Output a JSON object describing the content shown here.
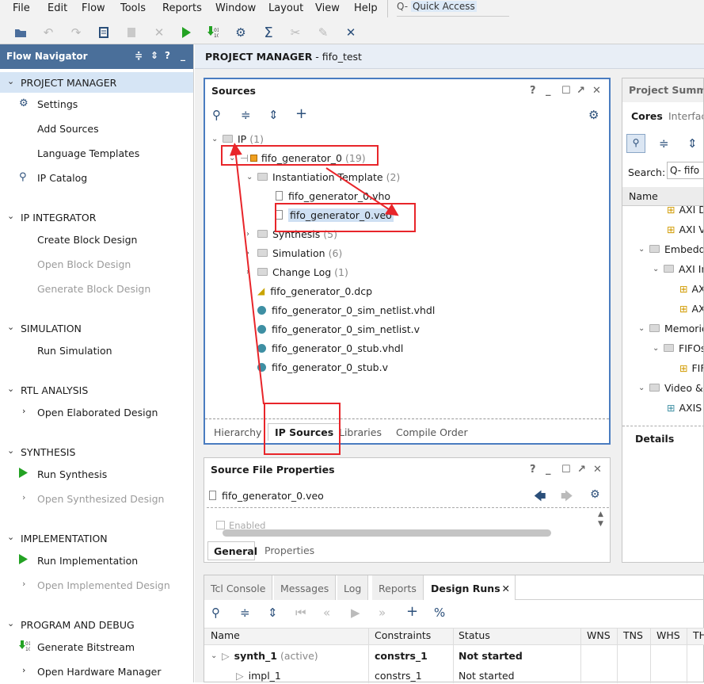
{
  "menu": [
    "File",
    "Edit",
    "Flow",
    "Tools",
    "Reports",
    "Window",
    "Layout",
    "View",
    "Help"
  ],
  "quick_access": {
    "prefix": "Q-",
    "label": "Quick Access"
  },
  "flow_navigator": {
    "title": "Flow Navigator",
    "sections": [
      {
        "label": "PROJECT MANAGER",
        "items": [
          {
            "label": "Settings",
            "icon": "gear-icon",
            "enabled": true
          },
          {
            "label": "Add Sources",
            "enabled": true
          },
          {
            "label": "Language Templates",
            "enabled": true
          },
          {
            "label": "IP Catalog",
            "icon": "ip-catalog-icon",
            "enabled": true
          }
        ]
      },
      {
        "label": "IP INTEGRATOR",
        "items": [
          {
            "label": "Create Block Design",
            "enabled": true
          },
          {
            "label": "Open Block Design",
            "enabled": false
          },
          {
            "label": "Generate Block Design",
            "enabled": false
          }
        ]
      },
      {
        "label": "SIMULATION",
        "items": [
          {
            "label": "Run Simulation",
            "enabled": true
          }
        ]
      },
      {
        "label": "RTL ANALYSIS",
        "items": [
          {
            "label": "Open Elaborated Design",
            "enabled": true
          }
        ]
      },
      {
        "label": "SYNTHESIS",
        "items": [
          {
            "label": "Run Synthesis",
            "icon": "play-icon",
            "enabled": true
          },
          {
            "label": "Open Synthesized Design",
            "enabled": false
          }
        ]
      },
      {
        "label": "IMPLEMENTATION",
        "items": [
          {
            "label": "Run Implementation",
            "icon": "play-icon",
            "enabled": true
          },
          {
            "label": "Open Implemented Design",
            "enabled": false
          }
        ]
      },
      {
        "label": "PROGRAM AND DEBUG",
        "items": [
          {
            "label": "Generate Bitstream",
            "icon": "bitstream-icon",
            "enabled": true
          },
          {
            "label": "Open Hardware Manager",
            "enabled": true
          }
        ]
      }
    ]
  },
  "project_bar": {
    "prefix": "PROJECT MANAGER",
    "suffix": " - fifo_test"
  },
  "sources": {
    "title": "Sources",
    "tree": [
      {
        "label": "IP",
        "count": "(1)"
      },
      {
        "label": "fifo_generator_0",
        "count": "(19)"
      },
      {
        "label": "Instantiation Template",
        "count": "(2)"
      },
      {
        "label": "fifo_generator_0.vho"
      },
      {
        "label": "fifo_generator_0.veo"
      },
      {
        "label": "Synthesis",
        "count": "(5)"
      },
      {
        "label": "Simulation",
        "count": "(6)"
      },
      {
        "label": "Change Log",
        "count": "(1)"
      },
      {
        "label": "fifo_generator_0.dcp"
      },
      {
        "label": "fifo_generator_0_sim_netlist.vhdl"
      },
      {
        "label": "fifo_generator_0_sim_netlist.v"
      },
      {
        "label": "fifo_generator_0_stub.vhdl"
      },
      {
        "label": "fifo_generator_0_stub.v"
      }
    ],
    "tabs": [
      "Hierarchy",
      "IP Sources",
      "Libraries",
      "Compile Order"
    ]
  },
  "source_file_properties": {
    "title": "Source File Properties",
    "file": "fifo_generator_0.veo",
    "enabled_label": "Enabled",
    "tabs": [
      "General",
      "Properties"
    ]
  },
  "project_summary": {
    "title": "Project Summary",
    "tabs": [
      "Cores",
      "Interfac"
    ],
    "search_label": "Search:",
    "search_value": "Q- fifo",
    "col": "Name",
    "rows": [
      "AXI D",
      "AXI Vi",
      "Embedd",
      "AXI In",
      "AX",
      "AX",
      "Memorie",
      "FIFOs",
      "FIF",
      "Video &",
      "AXIS"
    ],
    "details": "Details"
  },
  "console": {
    "tabs": [
      "Tcl Console",
      "Messages",
      "Log",
      "Reports",
      "Design Runs"
    ],
    "columns": [
      "Name",
      "Constraints",
      "Status",
      "WNS",
      "TNS",
      "WHS",
      "TH"
    ],
    "rows": [
      {
        "name": "synth_1",
        "tag": "(active)",
        "constraints": "constrs_1",
        "status": "Not started"
      },
      {
        "name": "impl_1",
        "constraints": "constrs_1",
        "status": "Not started"
      }
    ]
  }
}
